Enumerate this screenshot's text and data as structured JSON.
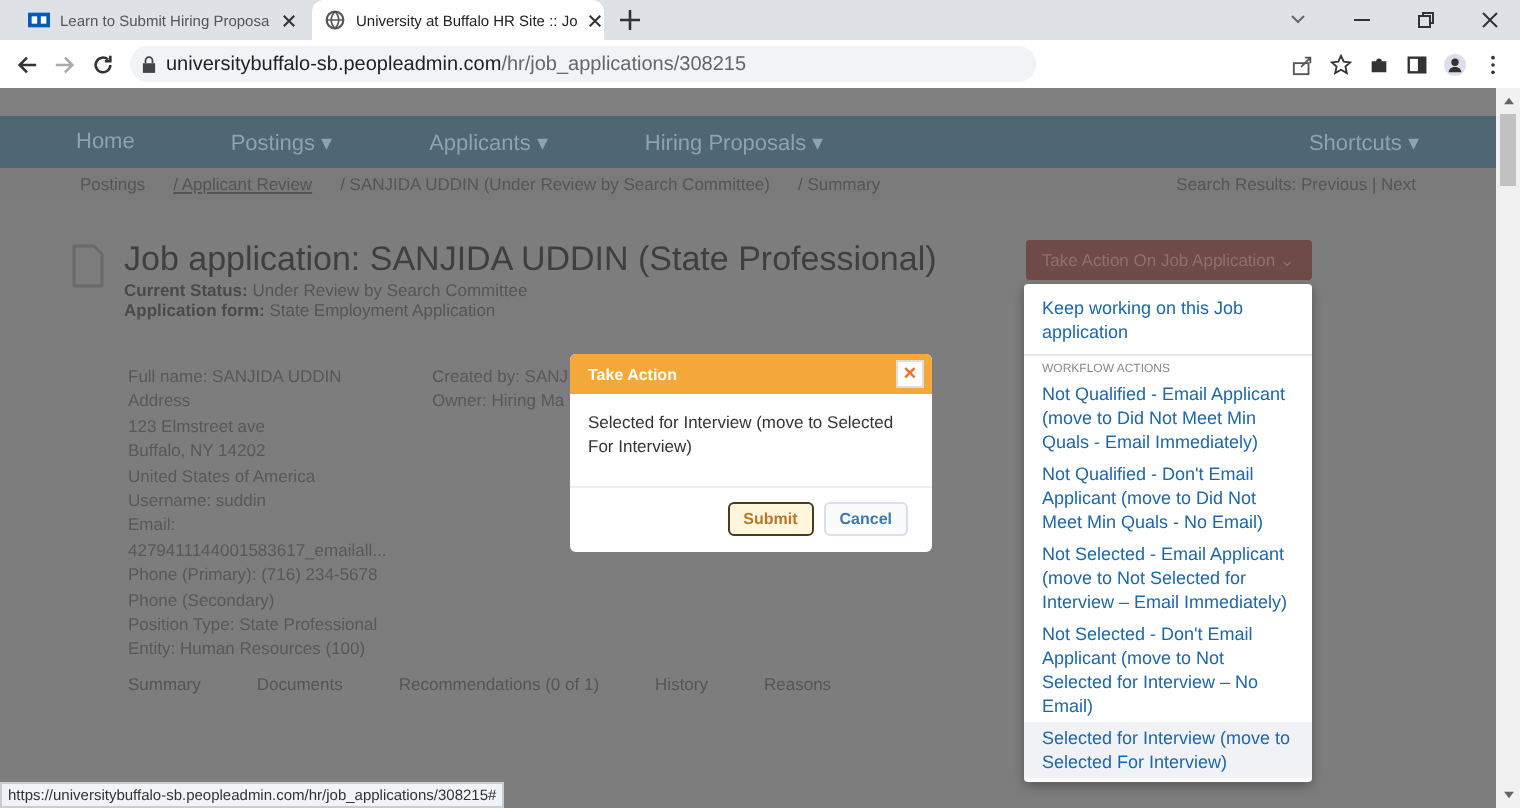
{
  "browser": {
    "tabs": [
      {
        "title": "Learn to Submit Hiring Proposa",
        "selected": false
      },
      {
        "title": "University at Buffalo HR Site :: Jo",
        "selected": true
      }
    ],
    "url_host": "universitybuffalo-sb.peopleadmin.com",
    "url_path": "/hr/job_applications/308215"
  },
  "nav": {
    "items": [
      "Home",
      "Postings ▾",
      "Applicants ▾",
      "Hiring Proposals ▾"
    ],
    "shortcuts": "Shortcuts ▾"
  },
  "breadcrumb": {
    "items": [
      "Postings",
      "/ Applicant Review",
      "/ SANJIDA UDDIN (Under Review by Search Committee)",
      "/ Summary"
    ],
    "search_nav": "Search Results: Previous | Next"
  },
  "page": {
    "title": "Job application: SANJIDA UDDIN (State Professional)",
    "status_label": "Current Status:",
    "status": "Under Review by Search Committee",
    "form_label": "Application form:",
    "form": "State Employment Application",
    "details": [
      "Full name: SANJIDA UDDIN",
      "Address",
      "123 Elmstreet ave",
      "Buffalo, NY 14202",
      "United States of America",
      "Username: suddin",
      "Email:",
      "4279411144001583617_emailall...",
      "Phone (Primary): (716) 234-5678",
      "Phone (Secondary)",
      "Position Type: State Professional",
      "Entity: Human Resources (100)"
    ],
    "side_details": [
      "Created by: SANJ",
      "Owner: Hiring Ma"
    ],
    "tabs": [
      "Summary",
      "Documents",
      "Recommendations (0 of 1)",
      "History",
      "Reasons"
    ]
  },
  "action_button": "Take Action On Job Application ⌄",
  "menu": {
    "first": "Keep working on this Job application",
    "section": "WORKFLOW ACTIONS",
    "items": [
      {
        "label": "Not Qualified - Email Applicant (move to Did Not Meet Min Quals - Email Immediately)",
        "selected": false
      },
      {
        "label": "Not Qualified - Don't Email Applicant (move to Did Not Meet Min Quals - No Email)",
        "selected": false
      },
      {
        "label": "Not Selected - Email Applicant (move to Not Selected for Interview – Email Immediately)",
        "selected": false
      },
      {
        "label": "Not Selected - Don't Email Applicant (move to Not Selected for Interview – No Email)",
        "selected": false
      },
      {
        "label": "Selected for Interview (move to Selected For Interview)",
        "selected": true
      }
    ]
  },
  "dialog": {
    "title": "Take Action",
    "close": "×",
    "message": "Selected for Interview (move to Selected For Interview)",
    "submit": "Submit",
    "cancel": "Cancel"
  },
  "status_url": "https://universitybuffalo-sb.peopleadmin.com/hr/job_applications/308215#"
}
